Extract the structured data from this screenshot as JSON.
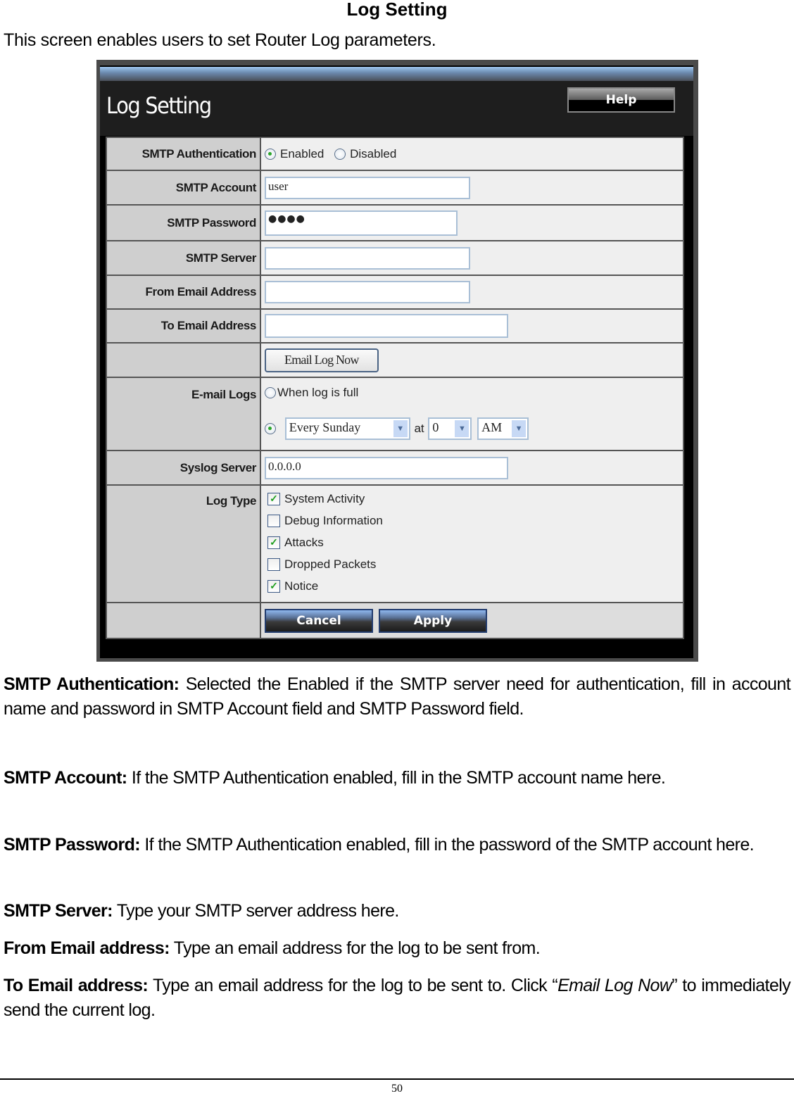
{
  "doc": {
    "heading": "Log Setting",
    "intro": "This screen enables users to set Router Log parameters."
  },
  "screenshot": {
    "title": "Log Setting",
    "help_label": "Help",
    "rows": {
      "smtp_auth": {
        "label": "SMTP Authentication",
        "options": [
          {
            "label": "Enabled",
            "selected": true
          },
          {
            "label": "Disabled",
            "selected": false
          }
        ]
      },
      "smtp_account": {
        "label": "SMTP Account",
        "value": "user"
      },
      "smtp_password": {
        "label": "SMTP Password",
        "value": "●●●●"
      },
      "smtp_server": {
        "label": "SMTP Server",
        "value": ""
      },
      "from_email": {
        "label": "From Email Address",
        "value": ""
      },
      "to_email": {
        "label": "To Email Address",
        "value": ""
      },
      "email_log_now_label": "Email Log Now",
      "email_logs": {
        "label": "E-mail Logs",
        "when_full_label": "When log is full",
        "when_full_selected": false,
        "schedule_selected": true,
        "schedule_day": "Every Sunday",
        "at_label": "at",
        "schedule_hour": "0",
        "schedule_ampm": "AM"
      },
      "syslog_server": {
        "label": "Syslog Server",
        "value": "0.0.0.0"
      },
      "log_type": {
        "label": "Log Type",
        "items": [
          {
            "label": "System Activity",
            "checked": true
          },
          {
            "label": "Debug Information",
            "checked": false
          },
          {
            "label": "Attacks",
            "checked": true
          },
          {
            "label": "Dropped Packets",
            "checked": false
          },
          {
            "label": "Notice",
            "checked": true
          }
        ]
      }
    },
    "cancel_label": "Cancel",
    "apply_label": "Apply"
  },
  "descriptions": [
    {
      "term": "SMTP Authentication:",
      "text": " Selected the Enabled if the SMTP server need for authentication, fill in account name and password in SMTP Account field and SMTP Password field."
    },
    {
      "term": "SMTP Account:",
      "text": " If the SMTP Authentication enabled, fill in the SMTP account name here."
    },
    {
      "term": "SMTP Password:",
      "text": " If the SMTP Authentication enabled, fill in the password of the SMTP account here."
    },
    {
      "term": "SMTP Server:",
      "text": " Type your SMTP server address here."
    },
    {
      "term": "From Email address:",
      "text": " Type an email address for the log to be sent from."
    },
    {
      "term": "To Email address:",
      "text": " Type an email address for the log to be sent to. Click “",
      "italic": "Email Log Now",
      "tail": "” to immediately send the current log."
    }
  ],
  "page_number": "50"
}
